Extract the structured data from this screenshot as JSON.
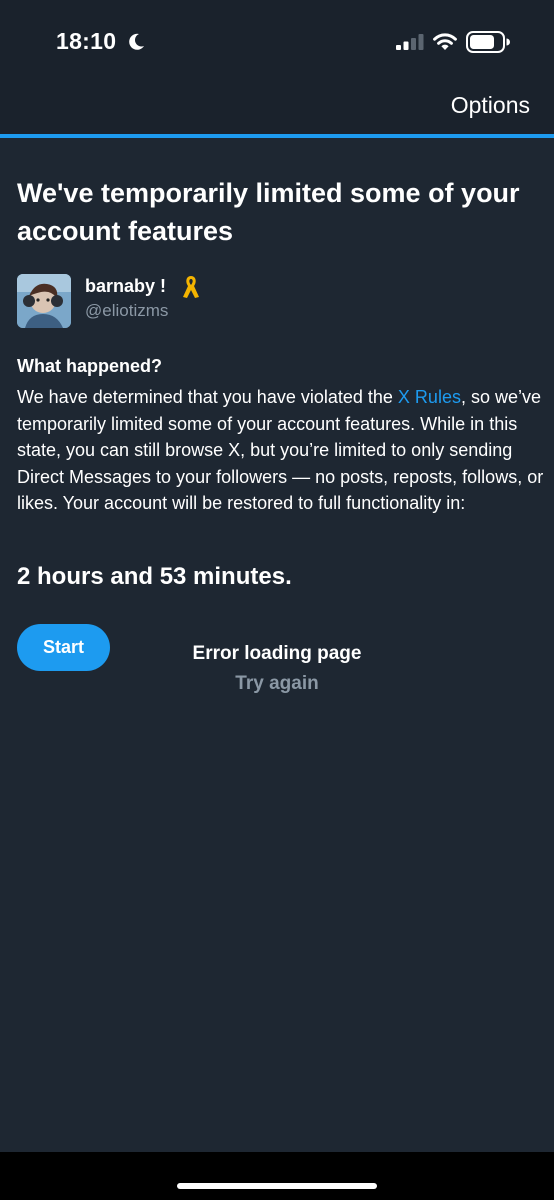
{
  "status_bar": {
    "time": "18:10",
    "icons": [
      "moon-icon",
      "signal-icon",
      "wifi-icon",
      "battery-icon"
    ]
  },
  "header": {
    "options_label": "Options",
    "accent_color": "#1d9bf0"
  },
  "main": {
    "title": "We've temporarily limited some of your account features",
    "user": {
      "name": "barnaby !",
      "handle": "@eliotizms",
      "badge_icon": "ribbon-icon"
    },
    "section_heading": "What happened?",
    "body_before_link": "We have determined that you have violated the ",
    "link_text": "X Rules",
    "body_after_link": ", so we’ve temporarily limited some of your account features. While in this state, you can still browse X, but you’re limited to only sending Direct Messages to your followers — no posts, reposts, follows, or likes. Your account will be restored to full functionality in:",
    "countdown": "2 hours and 53 minutes.",
    "start_label": "Start",
    "error_title": "Error loading page",
    "try_again_label": "Try again"
  },
  "colors": {
    "background": "#1e2732",
    "link": "#1d9bf0",
    "secondary_text": "#8b98a5"
  }
}
